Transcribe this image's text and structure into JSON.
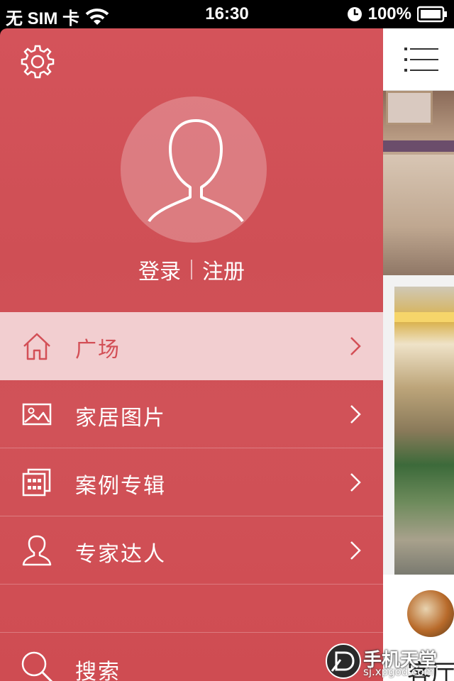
{
  "status_bar": {
    "carrier": "无 SIM 卡",
    "time": "16:30",
    "battery": "100%"
  },
  "drawer": {
    "login_label": "登录",
    "register_label": "注册",
    "menu": [
      {
        "label": "广场",
        "icon": "home-icon",
        "active": true
      },
      {
        "label": "家居图片",
        "icon": "image-icon",
        "active": false
      },
      {
        "label": "案例专辑",
        "icon": "album-icon",
        "active": false
      },
      {
        "label": "专家达人",
        "icon": "person-icon",
        "active": false
      }
    ],
    "search_label": "搜索"
  },
  "content": {
    "card_title": "客厅"
  },
  "watermark": {
    "title": "手机天堂",
    "url": "sj.xpgod.com"
  },
  "colors": {
    "drawer_bg": "#d4535a",
    "active_text": "#d34f56"
  }
}
